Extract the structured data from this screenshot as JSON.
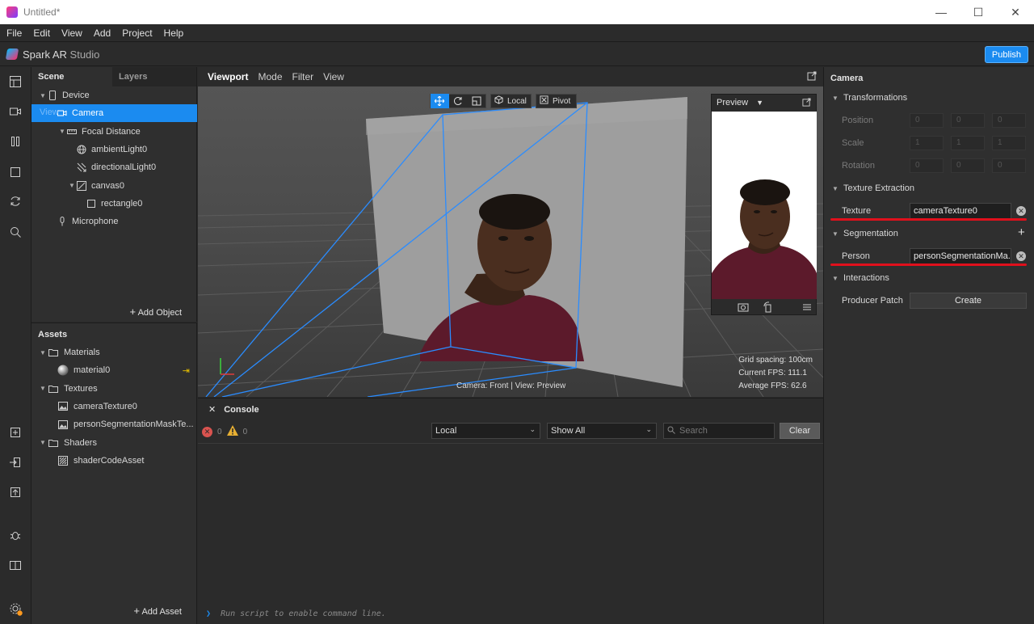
{
  "window": {
    "title": "Untitled*"
  },
  "menu": [
    "File",
    "Edit",
    "View",
    "Add",
    "Project",
    "Help"
  ],
  "app": {
    "brand_main": "Spark AR",
    "brand_sub": "Studio",
    "publish_label": "Publish",
    "accent": "#1b8bf0"
  },
  "scene": {
    "tabs": [
      "Scene",
      "Layers"
    ],
    "items": [
      {
        "label": "Device",
        "icon": "phone-icon",
        "indent": 0,
        "expanded": true
      },
      {
        "label": "Camera",
        "icon": "camera-icon",
        "indent": 1,
        "selected": true,
        "ghost": "View"
      },
      {
        "label": "Focal Distance",
        "icon": "ruler-icon",
        "indent": 2,
        "expanded": true
      },
      {
        "label": "ambientLight0",
        "icon": "globe-icon",
        "indent": 3
      },
      {
        "label": "directionalLight0",
        "icon": "directional-light-icon",
        "indent": 3
      },
      {
        "label": "canvas0",
        "icon": "canvas-icon",
        "indent": 3,
        "expanded": true
      },
      {
        "label": "rectangle0",
        "icon": "rectangle-icon",
        "indent": 4
      },
      {
        "label": "Microphone",
        "icon": "microphone-icon",
        "indent": 1
      }
    ],
    "add_object": "Add Object"
  },
  "assets": {
    "title": "Assets",
    "items": [
      {
        "label": "Materials",
        "type": "folder",
        "indent": 0
      },
      {
        "label": "material0",
        "type": "material",
        "indent": 1
      },
      {
        "label": "Textures",
        "type": "folder",
        "indent": 0
      },
      {
        "label": "cameraTexture0",
        "type": "texture",
        "indent": 1
      },
      {
        "label": "personSegmentationMaskTe...",
        "type": "texture",
        "indent": 1
      },
      {
        "label": "Shaders",
        "type": "folder",
        "indent": 0
      },
      {
        "label": "shaderCodeAsset",
        "type": "shader",
        "indent": 1
      }
    ],
    "add_asset": "Add Asset"
  },
  "viewport": {
    "tabs": [
      "Viewport",
      "Mode",
      "Filter",
      "View"
    ],
    "local_label": "Local",
    "pivot_label": "Pivot",
    "grid_spacing": "Grid spacing: 100cm",
    "current_fps": "Current FPS:  111.1",
    "average_fps": "Average FPS:  62.6",
    "camera_label": "Camera: Front | View: Preview",
    "preview_label": "Preview"
  },
  "console": {
    "title": "Console",
    "error_count": "0",
    "warning_count": "0",
    "scope": "Local",
    "filter": "Show All",
    "search_placeholder": "Search",
    "clear_label": "Clear",
    "command_hint": "Run script to enable command line."
  },
  "inspector": {
    "title": "Camera",
    "transformations": "Transformations",
    "position": "Position",
    "scale": "Scale",
    "rotation": "Rotation",
    "position_values": [
      "0",
      "0",
      "0"
    ],
    "scale_values": [
      "1",
      "1",
      "1"
    ],
    "rotation_values": [
      "0",
      "0",
      "0"
    ],
    "texture_extraction": "Texture Extraction",
    "texture_label": "Texture",
    "texture_value": "cameraTexture0",
    "segmentation": "Segmentation",
    "person_label": "Person",
    "person_value": "personSegmentationMa...",
    "interactions": "Interactions",
    "producer_patch": "Producer Patch",
    "create_label": "Create",
    "highlight_color": "#e0101c"
  }
}
